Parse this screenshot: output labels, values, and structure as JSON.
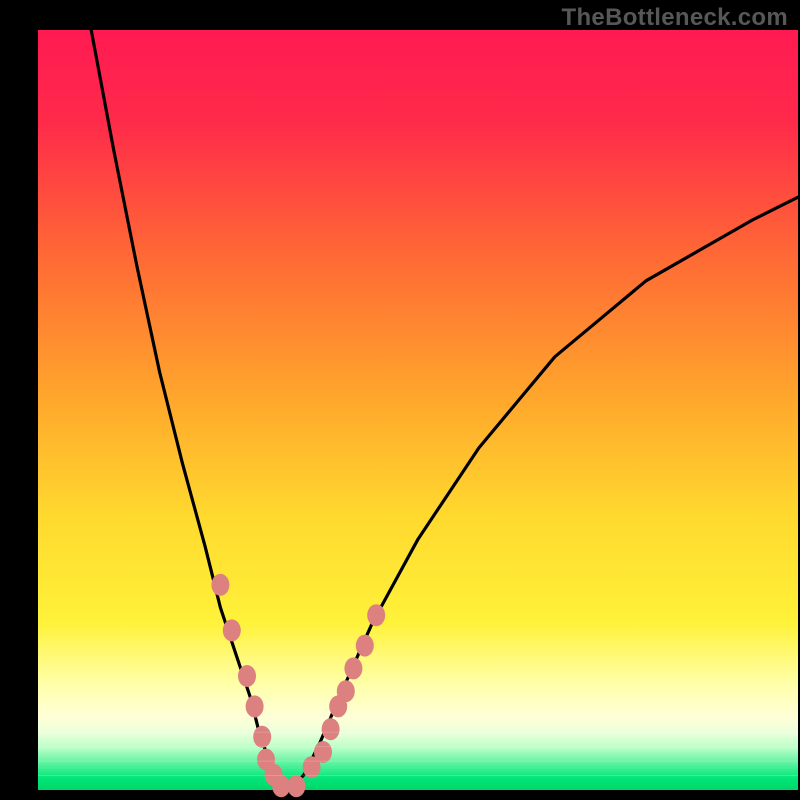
{
  "watermark": "TheBottleneck.com",
  "colors": {
    "black": "#000000",
    "red": "#ff1a52",
    "orange": "#ff8a2a",
    "yellow": "#ffe733",
    "paleYellow": "#ffffb0",
    "green": "#00e676",
    "curve": "#000000",
    "markerFill": "#dd8080",
    "markerStroke": "#cc6d6d"
  },
  "chart_data": {
    "type": "line",
    "title": "",
    "xlabel": "",
    "ylabel": "",
    "xlim": [
      0,
      100
    ],
    "ylim": [
      0,
      100
    ],
    "note": "Axes are unlabeled; x/y expressed as percentage of the gradient plot area (left/top = 0). y is visual position from top.",
    "series": [
      {
        "name": "curve-left-branch",
        "x": [
          7,
          10,
          13,
          16,
          19,
          22,
          24,
          26,
          28,
          29,
          30,
          31,
          32,
          33
        ],
        "y": [
          0,
          16,
          31,
          45,
          57,
          68,
          76,
          82,
          88,
          92,
          95,
          97,
          99,
          100
        ]
      },
      {
        "name": "curve-right-branch",
        "x": [
          33,
          35,
          37,
          40,
          44,
          50,
          58,
          68,
          80,
          94,
          100
        ],
        "y": [
          100,
          98,
          94,
          87,
          78,
          67,
          55,
          43,
          33,
          25,
          22
        ]
      }
    ],
    "markers": {
      "name": "pink-bead-markers",
      "x": [
        24.0,
        25.5,
        27.5,
        28.5,
        29.5,
        30.0,
        31.0,
        32.0,
        34.0,
        36.0,
        37.5,
        38.5,
        39.5,
        40.5,
        41.5,
        43.0,
        44.5
      ],
      "y": [
        73.0,
        79.0,
        85.0,
        89.0,
        93.0,
        96.0,
        98.0,
        99.5,
        99.5,
        97.0,
        95.0,
        92.0,
        89.0,
        87.0,
        84.0,
        81.0,
        77.0
      ]
    }
  }
}
